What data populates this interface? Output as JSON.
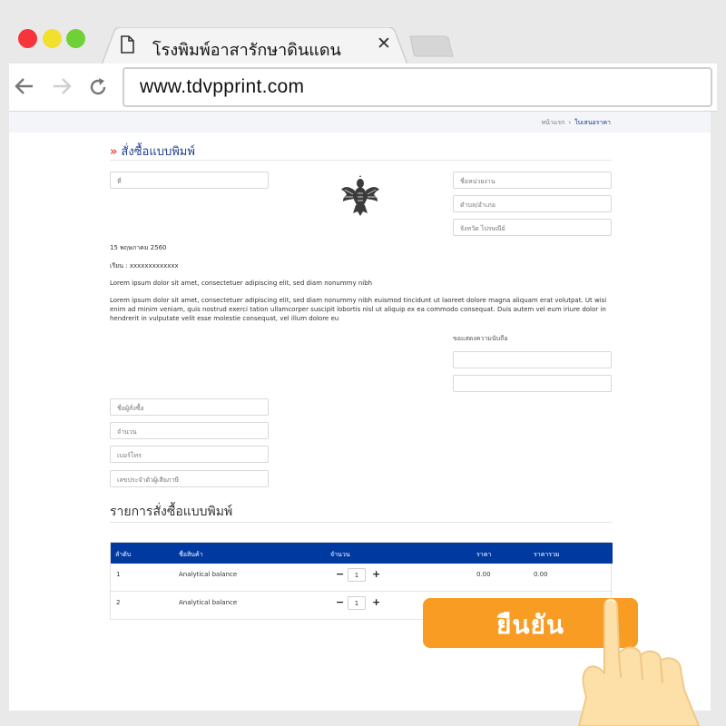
{
  "browser": {
    "tab_title": "โรงพิมพ์อาสารักษาดินแดน",
    "tab_close": "✕",
    "url": "www.tdvpprint.com"
  },
  "breadcrumb": {
    "home": "หน้าแรก",
    "separator": "›",
    "current": "ใบเสนอราคา"
  },
  "form": {
    "heading_marker": "»",
    "heading": "สั่งซื้อแบบพิมพ์",
    "ref_placeholder": "ที่",
    "agency_placeholder": "ชื่อหน่วยงาน",
    "district_placeholder": "ตำบล/อำเภอ",
    "province_placeholder": "จังหวัด ไปรษณีย์",
    "date": "15 พฤษภาคม 2560",
    "subject": "เรียน : xxxxxxxxxxxxx",
    "para1": "Lorem ipsum dolor sit amet, consectetuer adipiscing elit, sed diam nonummy nibh",
    "para2": "Lorem ipsum dolor sit amet, consectetuer adipiscing elit, sed diam nonummy nibh euismod tincidunt ut laoreet dolore magna aliquam erat volutpat. Ut wisi enim ad minim veniam, quis nostrud exerci tation ullamcorper suscipit lobortis nisl ut aliquip ex ea commodo consequat. Duis autem vel eum iriure dolor in hendrerit in vulputate velit esse molestie consequat, vel illum dolore eu",
    "signature_label": "ขอแสดงความนับถือ",
    "signature_value_1": "",
    "signature_value_2": "",
    "orderer_placeholder": "ชื่อผู้สั่งซื้อ",
    "quantity_placeholder": "จำนวน",
    "phone_placeholder": "เบอร์โทร",
    "taxid_placeholder": "เลขประจำตัวผู้เสียภาษี"
  },
  "order_table": {
    "title": "รายการสั่งซื้อแบบพิมพ์",
    "headers": {
      "no": "ลำดับ",
      "product": "ชื่อสินค้า",
      "qty": "จำนวน",
      "price": "ราคา",
      "total": "ราคารวม"
    },
    "rows": [
      {
        "no": "1",
        "product": "Analytical balance",
        "minus": "−",
        "qty": "1",
        "plus": "+",
        "price": "0.00",
        "total": "0.00"
      },
      {
        "no": "2",
        "product": "Analytical balance",
        "minus": "−",
        "qty": "1",
        "plus": "+",
        "price": "",
        "total": ""
      }
    ]
  },
  "confirm_button": "ยืนยัน",
  "colors": {
    "header_blue": "#003aa0",
    "heading_blue": "#1e3f8f",
    "confirm_orange": "#f89c24",
    "dot_red": "#f5353b",
    "dot_yellow": "#f2e02d",
    "dot_green": "#6fd135"
  },
  "icons": [
    "page-icon",
    "back-arrow-icon",
    "forward-arrow-icon",
    "reload-icon",
    "garuda-emblem",
    "pointing-hand"
  ]
}
